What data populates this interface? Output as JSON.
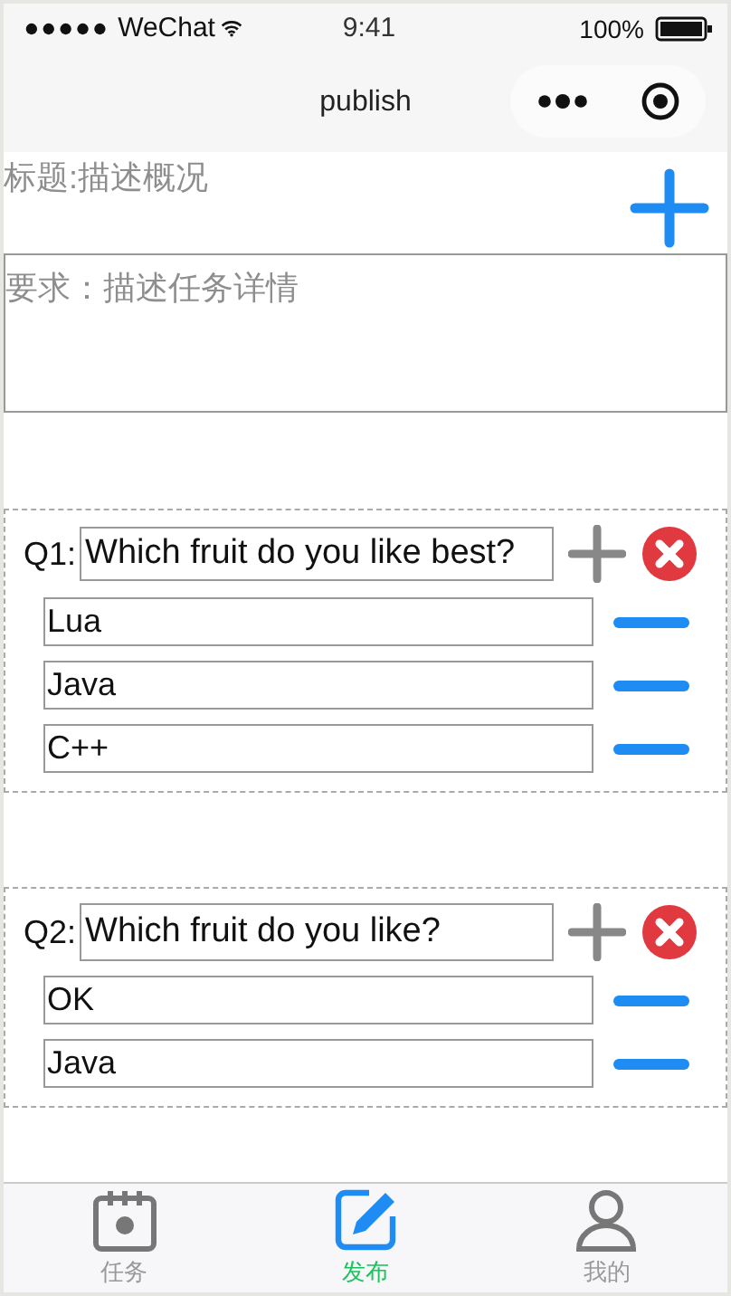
{
  "status_bar": {
    "carrier": "WeChat",
    "time": "9:41",
    "battery": "100%"
  },
  "nav": {
    "title": "publish"
  },
  "form": {
    "title_placeholder": "标题:描述概况",
    "requirement_placeholder": "要求：描述任务详情"
  },
  "questions": [
    {
      "label": "Q1:",
      "text": "Which fruit do you like best?",
      "options": [
        "Lua",
        "Java",
        "C++"
      ]
    },
    {
      "label": "Q2:",
      "text": "Which fruit do you like?",
      "options": [
        "OK",
        "Java"
      ]
    }
  ],
  "tabs": [
    {
      "label": "任务",
      "kind": "calendar",
      "selected": false
    },
    {
      "label": "发布",
      "kind": "edit",
      "selected": true
    },
    {
      "label": "我的",
      "kind": "person",
      "selected": false
    }
  ]
}
